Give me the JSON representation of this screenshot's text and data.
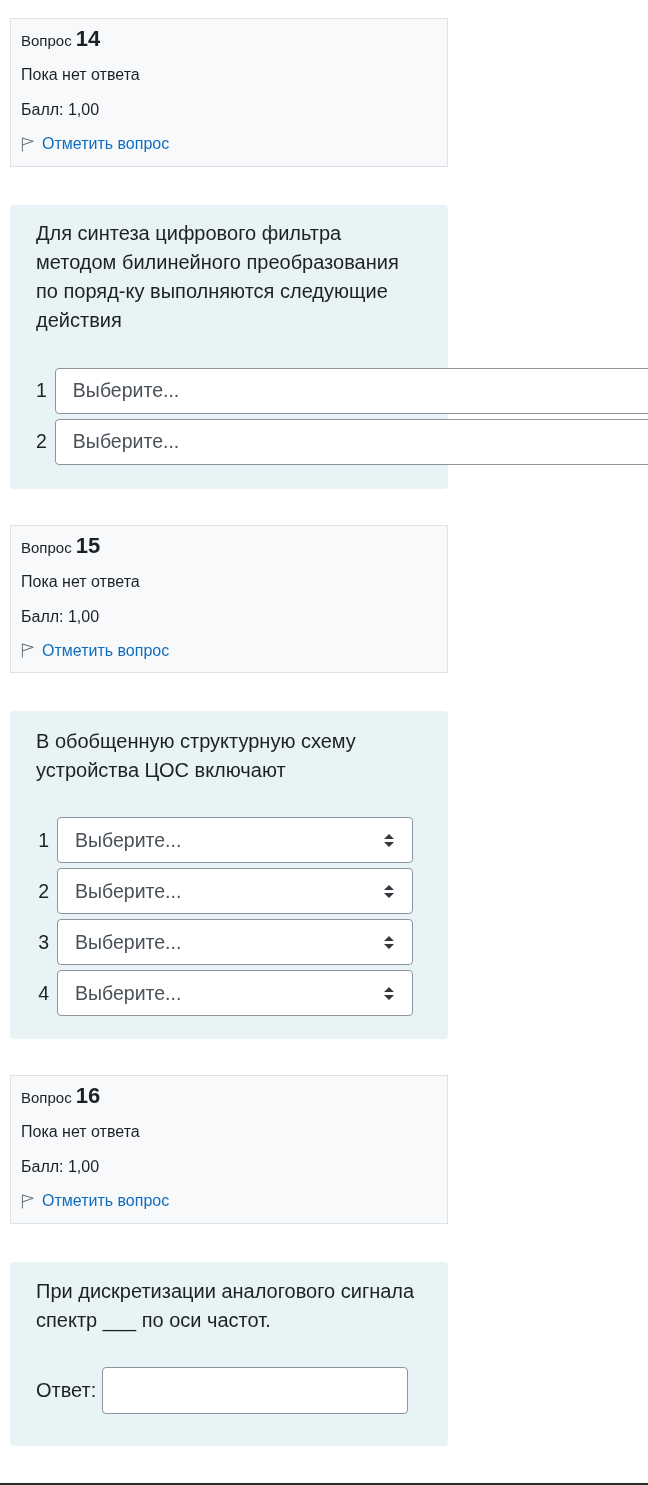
{
  "questions": [
    {
      "number_label": "Вопрос",
      "number": "14",
      "status": "Пока нет ответа",
      "grade": "Балл: 1,00",
      "flag_link": "Отметить вопрос",
      "text": "Для синтеза цифрового фильтра методом билинейного преобразования по поряд-ку выполняются следующие действия",
      "kind": "wideselect",
      "choices": [
        {
          "number": "1",
          "value": "Выберите..."
        },
        {
          "number": "2",
          "value": "Выберите..."
        }
      ]
    },
    {
      "number_label": "Вопрос",
      "number": "15",
      "status": "Пока нет ответа",
      "grade": "Балл: 1,00",
      "flag_link": "Отметить вопрос",
      "text": "В обобщенную структурную схему устройства ЦОС включают",
      "kind": "select",
      "choices": [
        {
          "number": "1",
          "value": "Выберите..."
        },
        {
          "number": "2",
          "value": "Выберите..."
        },
        {
          "number": "3",
          "value": "Выберите..."
        },
        {
          "number": "4",
          "value": "Выберите..."
        }
      ]
    },
    {
      "number_label": "Вопрос",
      "number": "16",
      "status": "Пока нет ответа",
      "grade": "Балл: 1,00",
      "flag_link": "Отметить вопрос",
      "text": "При дискретизации аналогового сигнала спектр ___ по оси частот.",
      "kind": "text",
      "answer_label": "Ответ:"
    }
  ]
}
